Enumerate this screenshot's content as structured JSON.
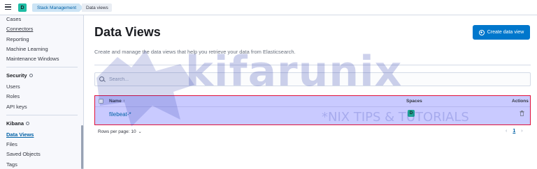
{
  "topbar": {
    "space_initial": "D",
    "breadcrumbs": [
      "Stack Management",
      "Data views"
    ]
  },
  "sidebar": {
    "top_items": [
      "Cases",
      "Connectors",
      "Reporting",
      "Machine Learning",
      "Maintenance Windows"
    ],
    "security": {
      "heading": "Security",
      "items": [
        "Users",
        "Roles",
        "API keys"
      ]
    },
    "kibana": {
      "heading": "Kibana",
      "items": [
        "Data Views",
        "Files",
        "Saved Objects",
        "Tags"
      ],
      "active": "Data Views"
    }
  },
  "main": {
    "title": "Data Views",
    "create_button": "Create data view",
    "description": "Create and manage the data views that help you retrieve your data from Elasticsearch.",
    "search": {
      "placeholder": "Search..."
    },
    "table": {
      "columns": [
        "Name",
        "Spaces",
        "Actions"
      ],
      "rows": [
        {
          "name": "filebeat-*",
          "space": "D"
        }
      ]
    },
    "pagination": {
      "rows_per_page": "Rows per page: 10",
      "current_page": "1",
      "prev": "‹",
      "next": "›"
    }
  },
  "watermark": {
    "brand": "kifarunix",
    "tagline": "*NIX TIPS & TUTORIALS"
  },
  "colors": {
    "accent": "#0077cc",
    "highlight_fill": "#c9caff",
    "highlight_border": "#e0103a",
    "space_badge": "#1ebda5"
  }
}
